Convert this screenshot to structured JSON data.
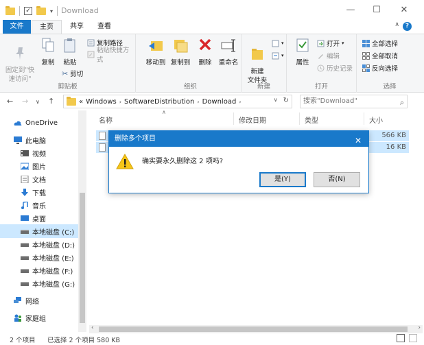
{
  "window": {
    "title": "Download",
    "minimize": "—",
    "maximize": "☐",
    "close": "✕"
  },
  "tabs": {
    "file": "文件",
    "home": "主页",
    "share": "共享",
    "view": "查看"
  },
  "ribbon": {
    "clipboard": {
      "pin": "固定到\"快\n速访问\"",
      "copy": "复制",
      "paste": "粘贴",
      "copy_path": "复制路径",
      "paste_shortcut": "粘贴快捷方式",
      "cut": "剪切",
      "label": "剪贴板"
    },
    "organize": {
      "move_to": "移动到",
      "copy_to": "复制到",
      "delete": "删除",
      "rename": "重命名",
      "label": "组织"
    },
    "new": {
      "new_folder": "新建\n文件夹",
      "label": "新建"
    },
    "open": {
      "properties": "属性",
      "open": "打开",
      "edit": "编辑",
      "history": "历史记录",
      "label": "打开"
    },
    "select": {
      "select_all": "全部选择",
      "select_none": "全部取消",
      "invert": "反向选择",
      "label": "选择"
    }
  },
  "address": {
    "crumbs": [
      "Windows",
      "SoftwareDistribution",
      "Download"
    ],
    "lead": "«"
  },
  "search": {
    "placeholder": "搜索\"Download\""
  },
  "sidebar": {
    "items": [
      {
        "label": "OneDrive",
        "icon": "cloud-icon"
      },
      {
        "label": "此电脑",
        "icon": "computer-icon"
      },
      {
        "label": "视频",
        "icon": "video-icon"
      },
      {
        "label": "图片",
        "icon": "picture-icon"
      },
      {
        "label": "文档",
        "icon": "document-icon"
      },
      {
        "label": "下载",
        "icon": "download-icon"
      },
      {
        "label": "音乐",
        "icon": "music-icon"
      },
      {
        "label": "桌面",
        "icon": "desktop-icon"
      },
      {
        "label": "本地磁盘 (C:)",
        "icon": "drive-icon",
        "selected": true
      },
      {
        "label": "本地磁盘 (D:)",
        "icon": "drive-icon"
      },
      {
        "label": "本地磁盘 (E:)",
        "icon": "drive-icon"
      },
      {
        "label": "本地磁盘 (F:)",
        "icon": "drive-icon"
      },
      {
        "label": "本地磁盘 (G:)",
        "icon": "drive-icon"
      },
      {
        "label": "网络",
        "icon": "network-icon"
      },
      {
        "label": "家庭组",
        "icon": "homegroup-icon"
      }
    ]
  },
  "filelist": {
    "columns": [
      "名称",
      "修改日期",
      "类型",
      "大小"
    ],
    "rows": [
      {
        "size": "566 KB"
      },
      {
        "size": "16 KB"
      }
    ]
  },
  "status": {
    "count": "2 个项目",
    "selected": "已选择 2 个项目  580 KB"
  },
  "dialog": {
    "title": "删除多个项目",
    "message": "确实要永久删除这 2 项吗?",
    "yes": "是(Y)",
    "no": "否(N)"
  },
  "colors": {
    "accent": "#1979ca",
    "selection": "#cce8ff",
    "folder": "#f2c94c"
  }
}
